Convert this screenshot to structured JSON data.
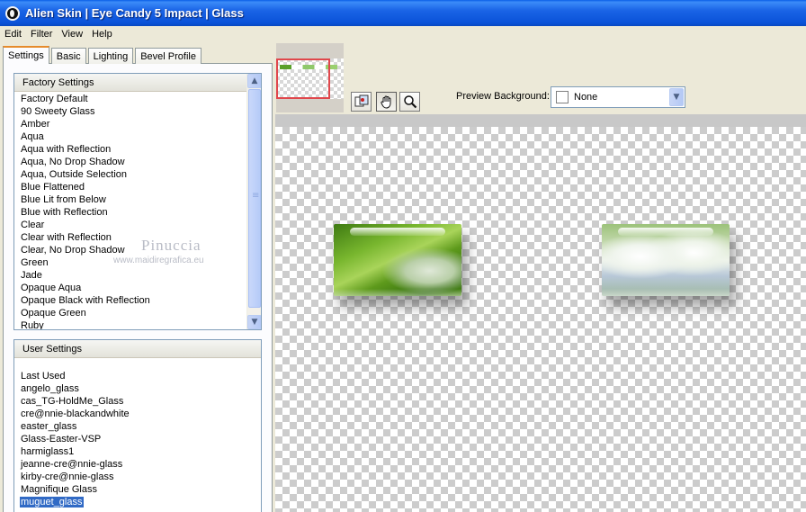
{
  "window": {
    "title": "Alien Skin | Eye Candy 5 Impact | Glass"
  },
  "menu": [
    "Edit",
    "Filter",
    "View",
    "Help"
  ],
  "tabs": [
    "Settings",
    "Basic",
    "Lighting",
    "Bevel Profile"
  ],
  "factory": {
    "header": "Factory Settings",
    "items": [
      "Factory Default",
      "90 Sweety Glass",
      "Amber",
      "Aqua",
      "Aqua with Reflection",
      "Aqua, No Drop Shadow",
      "Aqua, Outside Selection",
      "Blue Flattened",
      "Blue Lit from Below",
      "Blue with Reflection",
      "Clear",
      "Clear with Reflection",
      "Clear, No Drop Shadow",
      "Green",
      "Jade",
      "Opaque Aqua",
      "Opaque Black with Reflection",
      "Opaque Green",
      "Ruby"
    ]
  },
  "user": {
    "header": "User Settings",
    "items": [
      "Last Used",
      "angelo_glass",
      "cas_TG-HoldMe_Glass",
      "cre@nnie-blackandwhite",
      "easter_glass",
      "Glass-Easter-VSP",
      "harmiglass1",
      "jeanne-cre@nnie-glass",
      "kirby-cre@nnie-glass",
      "Magnifique Glass",
      "muguet_glass"
    ],
    "selected": "muguet_glass"
  },
  "watermark": {
    "name": "Pinuccia",
    "url": "www.maidiregrafica.eu"
  },
  "preview_background": {
    "label": "Preview Background:",
    "value": "None"
  },
  "icons": {
    "title": "alien-skin-logo-icon",
    "tool1": "preview-compare-icon",
    "tool2": "hand-pan-icon",
    "tool3": "zoom-magnifier-icon"
  },
  "colors": {
    "titlebar": "#0a5fe8",
    "selection": "#316ac5",
    "active_tab_accent": "#e68b2c",
    "thumb_frame": "#e0474c"
  }
}
